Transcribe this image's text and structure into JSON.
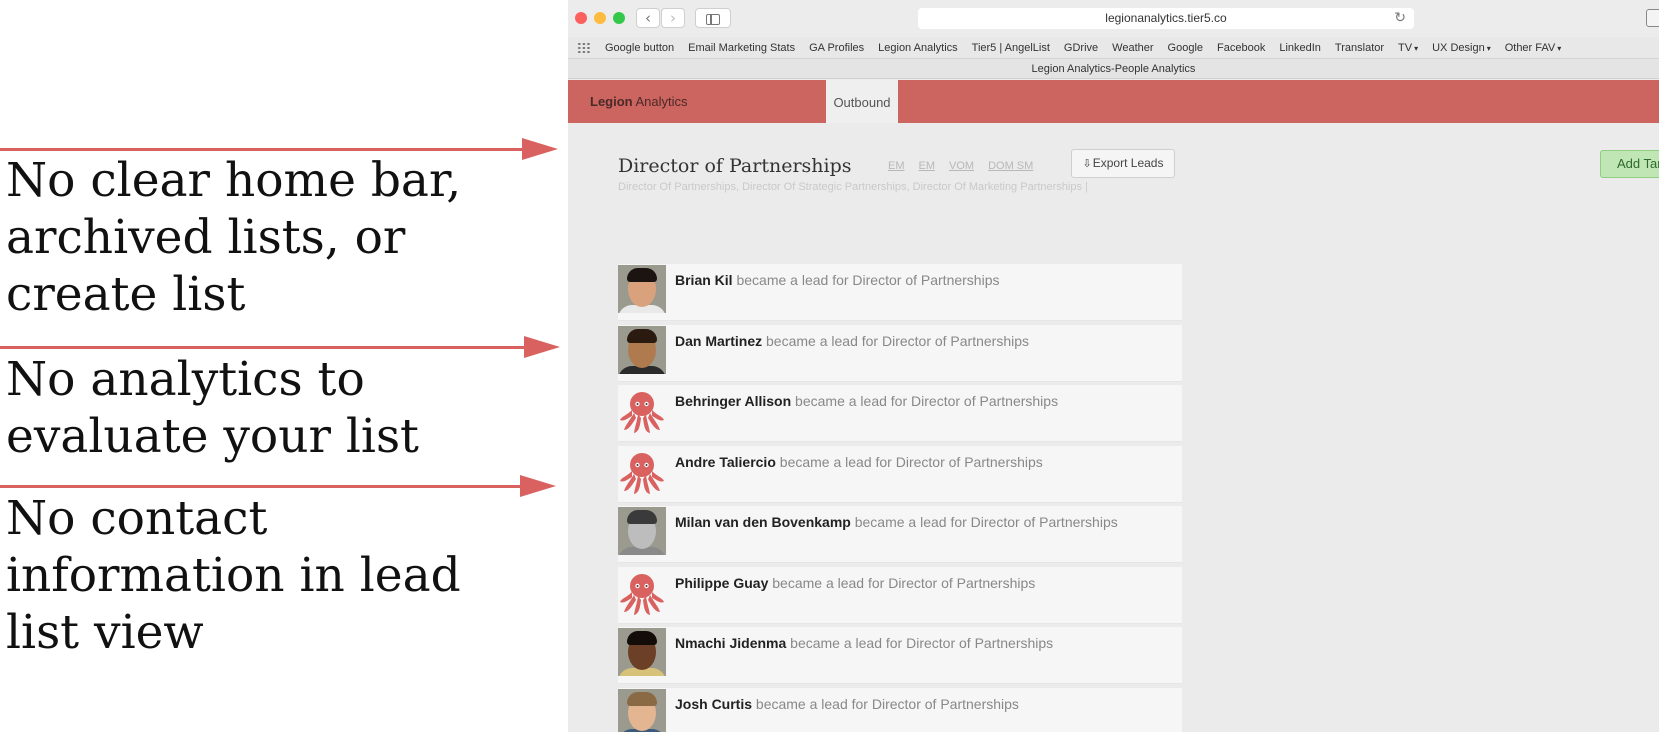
{
  "annotations": [
    {
      "text": "No clear home bar,\narchived lists, or\ncreate list"
    },
    {
      "text": "No analytics to\nevaluate your list"
    },
    {
      "text": "No contact\ninformation in lead\nlist view"
    }
  ],
  "colors": {
    "annotation_arrow": "#d9615f",
    "app_bar": "#cc645f",
    "add_button": "#bfe6b4",
    "octopus": "#d9615f"
  },
  "browser": {
    "url": "legionanalytics.tier5.co",
    "page_title": "Legion Analytics-People Analytics",
    "bookmarks": [
      {
        "label": "Google button",
        "dropdown": false
      },
      {
        "label": "Email Marketing Stats",
        "dropdown": false
      },
      {
        "label": "GA Profiles",
        "dropdown": false
      },
      {
        "label": "Legion Analytics",
        "dropdown": false
      },
      {
        "label": "Tier5 | AngelList",
        "dropdown": false
      },
      {
        "label": "GDrive",
        "dropdown": false
      },
      {
        "label": "Weather",
        "dropdown": false
      },
      {
        "label": "Google",
        "dropdown": false
      },
      {
        "label": "Facebook",
        "dropdown": false
      },
      {
        "label": "LinkedIn",
        "dropdown": false
      },
      {
        "label": "Translator",
        "dropdown": false
      },
      {
        "label": "TV",
        "dropdown": true
      },
      {
        "label": "UX Design",
        "dropdown": true
      },
      {
        "label": "Other FAV",
        "dropdown": true
      }
    ]
  },
  "app": {
    "brand_bold": "Legion",
    "brand_rest": "Analytics",
    "active_tab": "Outbound"
  },
  "list": {
    "title": "Director of Partnerships",
    "filters": [
      "EM",
      "EM",
      "VOM",
      "DOM SM"
    ],
    "export_label": "Export Leads",
    "subtitle": "Director Of Partnerships, Director Of Strategic Partnerships, Director Of Marketing Partnerships |",
    "add_button_label": "Add Tar"
  },
  "leads": [
    {
      "name": "Brian Kil",
      "action": "became a lead for Director of Partnerships",
      "avatar": "photo",
      "skin": "#d9a27c",
      "hair": "#1c1410",
      "shirt": "#e9e9e9"
    },
    {
      "name": "Dan Martinez",
      "action": "became a lead for Director of Partnerships",
      "avatar": "photo",
      "skin": "#b07a4f",
      "hair": "#2a1a10",
      "shirt": "#2b2b2b"
    },
    {
      "name": "Behringer Allison",
      "action": "became a lead for Director of Partnerships",
      "avatar": "octopus"
    },
    {
      "name": "Andre Taliercio",
      "action": "became a lead for Director of Partnerships",
      "avatar": "octopus"
    },
    {
      "name": "Milan van den Bovenkamp",
      "action": "became a lead for Director of Partnerships",
      "avatar": "photo",
      "skin": "#bdbdbd",
      "hair": "#3a3a3a",
      "shirt": "#8a8a8a"
    },
    {
      "name": "Philippe Guay",
      "action": "became a lead for Director of Partnerships",
      "avatar": "octopus"
    },
    {
      "name": "Nmachi Jidenma",
      "action": "became a lead for Director of Partnerships",
      "avatar": "photo",
      "skin": "#6b4026",
      "hair": "#140c08",
      "shirt": "#d8c27a"
    },
    {
      "name": "Josh Curtis",
      "action": "became a lead for Director of Partnerships",
      "avatar": "photo",
      "skin": "#e3b590",
      "hair": "#8a6a45",
      "shirt": "#3d5a7a"
    }
  ]
}
